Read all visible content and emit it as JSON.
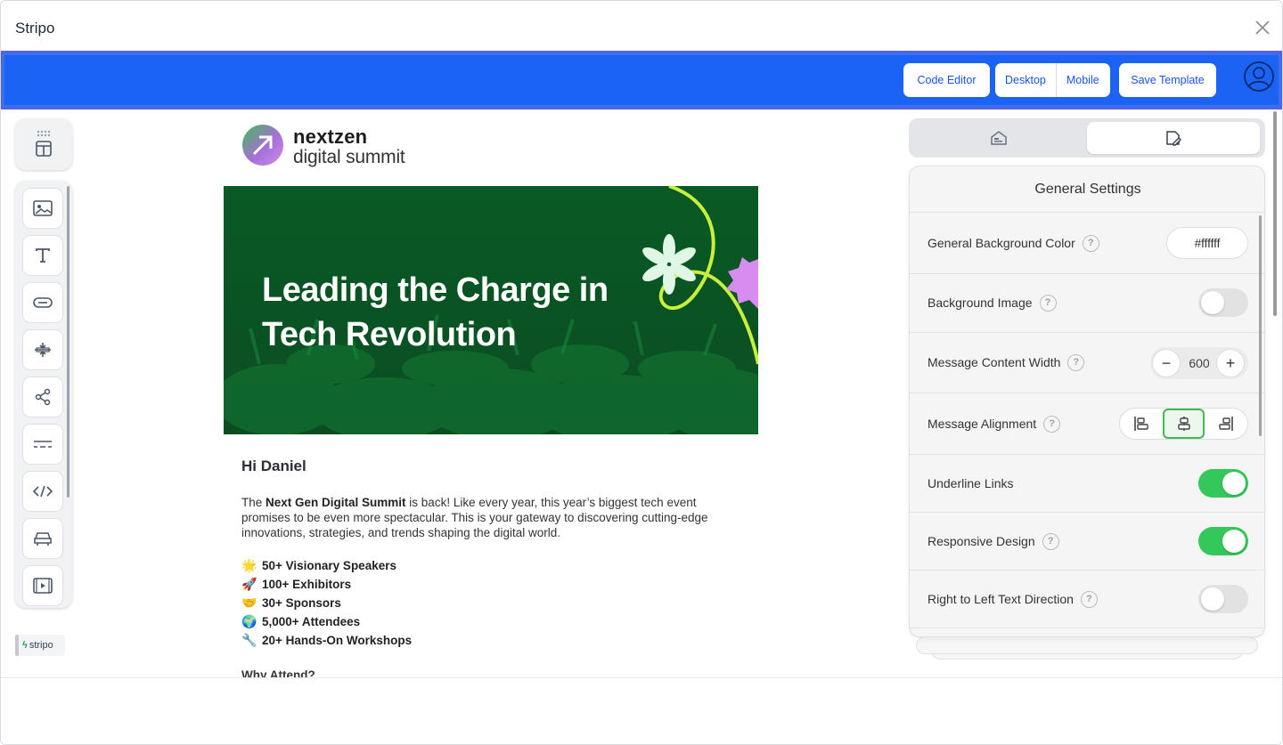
{
  "window": {
    "title": "Stripo"
  },
  "toolbar": {
    "code_editor": "Code Editor",
    "desktop": "Desktop",
    "mobile": "Mobile",
    "save_template": "Save Template"
  },
  "email": {
    "logo_line1": "nextzen",
    "logo_line2": "digital summit",
    "hero_title": "Leading the Charge in Tech Revolution",
    "greeting": "Hi Daniel",
    "intro_prefix": "The ",
    "intro_bold": "Next Gen Digital Summit",
    "intro_rest": " is back! Like every year, this year’s biggest tech event promises to be even more spectacular. This is your gateway to discovering cutting-edge innovations, strategies, and trends shaping the digital world.",
    "highlights": [
      {
        "emoji": "🌟",
        "text": "50+ Visionary Speakers"
      },
      {
        "emoji": "🚀",
        "text": "100+ Exhibitors"
      },
      {
        "emoji": "🤝",
        "text": "30+ Sponsors"
      },
      {
        "emoji": "🌍",
        "text": "5,000+ Attendees"
      },
      {
        "emoji": "🔧",
        "text": "20+ Hands-On Workshops"
      }
    ],
    "why_heading": "Why Attend?"
  },
  "branding": {
    "stripo_badge": "stripo"
  },
  "settings": {
    "title": "General Settings",
    "bg_color_label": "General Background Color",
    "bg_color_value": "#ffffff",
    "bg_image_label": "Background Image",
    "content_width_label": "Message Content Width",
    "content_width_value": "600",
    "alignment_label": "Message Alignment",
    "alignment_selected": "center",
    "underline_links_label": "Underline Links",
    "underline_links": true,
    "responsive_label": "Responsive Design",
    "responsive": true,
    "rtl_label": "Right to Left Text Direction",
    "rtl": false,
    "bg_image": false
  },
  "colors": {
    "toolbar_blue": "#1a63f5",
    "toggle_on": "#34c759",
    "hero_green": "#0c5c2a",
    "accent_lime": "#c6f03b",
    "accent_pink": "#d98cf0"
  }
}
